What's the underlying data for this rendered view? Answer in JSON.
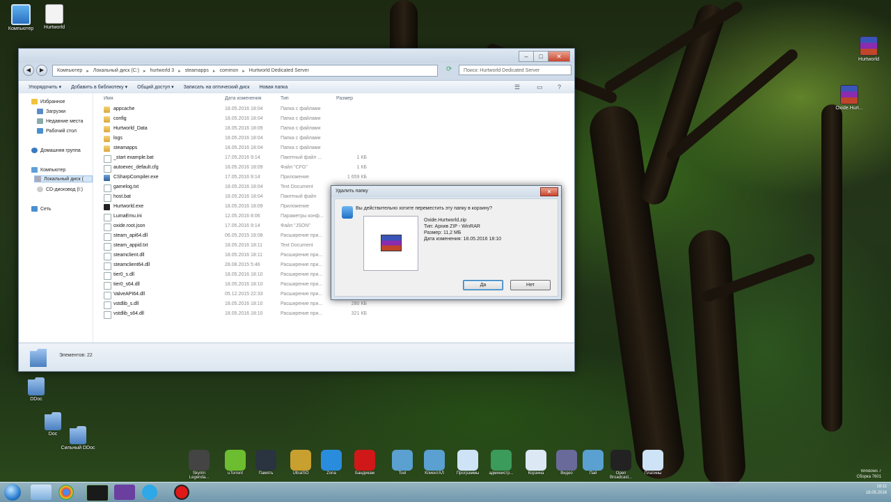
{
  "explorer": {
    "address": [
      "Компьютер",
      "Локальный диск (C:)",
      "hurtworld 3",
      "steamapps",
      "common",
      "Hurtworld Dedicated Server"
    ],
    "search_placeholder": "Поиск: Hurtworld Dedicated Server",
    "toolbar": [
      "Упорядочить ▾",
      "Добавить в библиотеку ▾",
      "Общий доступ ▾",
      "Записать на оптический диск",
      "Новая папка"
    ],
    "nav": [
      "Избранное",
      "Загрузки",
      "Недавние места",
      "Рабочий стол",
      "Домашняя группа",
      "Компьютер",
      "Локальный диск (",
      "CD-дисковод (I:)",
      "Сеть"
    ],
    "columns": {
      "name": "Имя",
      "date": "Дата изменения",
      "type": "Тип",
      "size": "Размер"
    },
    "files": [
      {
        "icon": "folder",
        "name": "appcache",
        "date": "18.05.2016 18:04",
        "type": "Папка с файлами",
        "size": ""
      },
      {
        "icon": "folder",
        "name": "config",
        "date": "18.05.2016 18:04",
        "type": "Папка с файлами",
        "size": ""
      },
      {
        "icon": "folder",
        "name": "Hurtworld_Data",
        "date": "18.05.2016 18:09",
        "type": "Папка с файлами",
        "size": ""
      },
      {
        "icon": "folder",
        "name": "logs",
        "date": "18.05.2016 18:04",
        "type": "Папка с файлами",
        "size": ""
      },
      {
        "icon": "folder",
        "name": "steamapps",
        "date": "18.05.2016 18:04",
        "type": "Папка с файлами",
        "size": ""
      },
      {
        "icon": "file",
        "name": "_start example.bat",
        "date": "17.05.2016 9:14",
        "type": "Пакетный файл ...",
        "size": "1 КБ"
      },
      {
        "icon": "file",
        "name": "autoexec_default.cfg",
        "date": "18.05.2016 18:09",
        "type": "Файл \"CFG\"",
        "size": "1 КБ"
      },
      {
        "icon": "exe",
        "name": "CSharpCompiler.exe",
        "date": "17.05.2016 9:14",
        "type": "Приложение",
        "size": "1 659 КБ"
      },
      {
        "icon": "file",
        "name": "gamelog.txt",
        "date": "18.05.2016 18:04",
        "type": "Text Document",
        "size": ""
      },
      {
        "icon": "file",
        "name": "host.bat",
        "date": "18.05.2016 18:04",
        "type": "Пакетный файл",
        "size": ""
      },
      {
        "icon": "dark",
        "name": "Hurtworld.exe",
        "date": "18.05.2016 18:09",
        "type": "Приложение",
        "size": ""
      },
      {
        "icon": "file",
        "name": "LumaEmu.ini",
        "date": "12.05.2016 8:06",
        "type": "Параметры конф...",
        "size": ""
      },
      {
        "icon": "file",
        "name": "oxide.root.json",
        "date": "17.05.2016 9:14",
        "type": "Файл \"JSON\"",
        "size": ""
      },
      {
        "icon": "file",
        "name": "steam_api64.dll",
        "date": "06.05.2015 18:08",
        "type": "Расширение при...",
        "size": ""
      },
      {
        "icon": "file",
        "name": "steam_appid.txt",
        "date": "18.05.2016 18:11",
        "type": "Text Document",
        "size": ""
      },
      {
        "icon": "file",
        "name": "steamclient.dll",
        "date": "18.05.2016 18:11",
        "type": "Расширение при...",
        "size": ""
      },
      {
        "icon": "file",
        "name": "steamclient64.dll",
        "date": "28.08.2015 5:46",
        "type": "Расширение при...",
        "size": ""
      },
      {
        "icon": "file",
        "name": "tier0_s.dll",
        "date": "18.05.2016 18:10",
        "type": "Расширение при...",
        "size": ""
      },
      {
        "icon": "file",
        "name": "tier0_s64.dll",
        "date": "18.05.2016 18:10",
        "type": "Расширение при...",
        "size": ""
      },
      {
        "icon": "file",
        "name": "ValveAPI64.dll",
        "date": "05.12.2015 22:33",
        "type": "Расширение при...",
        "size": ""
      },
      {
        "icon": "file",
        "name": "vstdlib_s.dll",
        "date": "18.05.2016 18:10",
        "type": "Расширение при...",
        "size": "280 КБ"
      },
      {
        "icon": "file",
        "name": "vstdlib_s64.dll",
        "date": "18.05.2016 18:10",
        "type": "Расширение при...",
        "size": "321 КБ"
      }
    ],
    "status": "Элементов: 22"
  },
  "dialog": {
    "title": "Удалить папку",
    "close": "✕",
    "question": "Вы действительно хотите переместить эту папку в корзину?",
    "file_info": [
      "Oxide.Hurtworld.zip",
      "Тип: Архив ZIP - WinRAR",
      "Размер: 11,2 МБ",
      "Дата изменения: 18.05.2016 18:10"
    ],
    "yes": "Да",
    "no": "Нет"
  },
  "desktop_icons": [
    {
      "label": "Компьютер",
      "icon": "pc"
    },
    {
      "label": "Hurtworld",
      "icon": "doc"
    },
    {
      "label": "DDoc",
      "icon": "folder"
    },
    {
      "label": "Doc",
      "icon": "folder"
    },
    {
      "label": "Сильный DDoc",
      "icon": "folder"
    },
    {
      "label": "Hurtworld",
      "icon": "rar"
    },
    {
      "label": "Oxide.Hurt...",
      "icon": "rar"
    }
  ],
  "dock_items": [
    {
      "label": "Skyrim Legenda...",
      "color": "#444444"
    },
    {
      "label": "uTorrent",
      "color": "#6cbe30"
    },
    {
      "label": "Память",
      "color": "#2a3340"
    },
    {
      "label": "UltraISO",
      "color": "#c8a030"
    },
    {
      "label": "Zona",
      "color": "#2a8cdc"
    },
    {
      "label": "Бандикам",
      "color": "#d01818"
    },
    {
      "label": "Tool",
      "color": "#5aa0d0"
    },
    {
      "label": "КлиентАЛ",
      "color": "#5aa0d0"
    },
    {
      "label": "Программы",
      "color": "#cfe3f7"
    },
    {
      "label": "администр...",
      "color": "#3b9b5a"
    },
    {
      "label": "Корзина",
      "color": "#dce8f4"
    },
    {
      "label": "Видео",
      "color": "#6a6a9a"
    },
    {
      "label": "Пай",
      "color": "#5aa0d0"
    },
    {
      "label": "Open Broadcast...",
      "color": "#222222"
    },
    {
      "label": "Платины",
      "color": "#cfe3f7"
    }
  ],
  "taskbar": {
    "apps": [
      "explorer",
      "chrome",
      "cmd",
      "visual-studio",
      "skype",
      "bandicam"
    ],
    "time": "18:11",
    "date": "18.05.2016"
  },
  "watermark": [
    "Windows 7",
    "Сборка 7601"
  ]
}
